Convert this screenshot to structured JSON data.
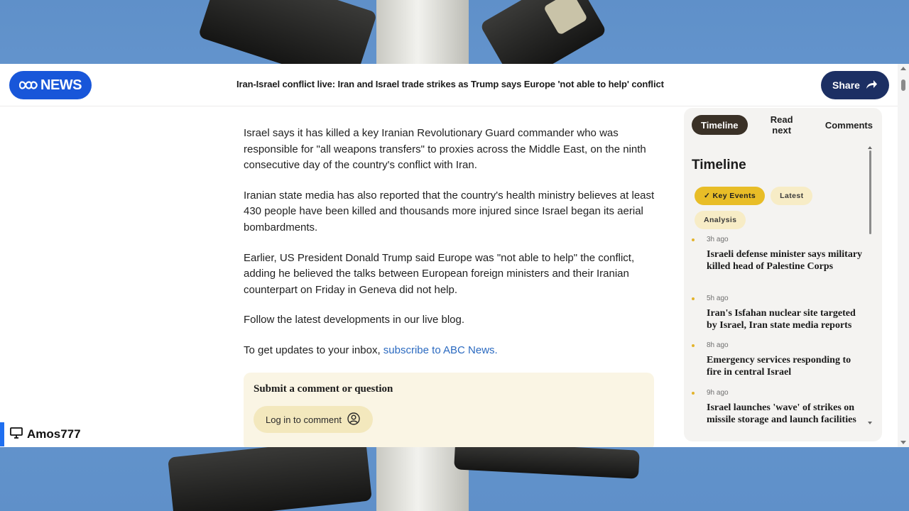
{
  "header": {
    "logo_text": "NEWS",
    "headline": "Iran-Israel conflict live: Iran and Israel trade strikes as Trump says Europe 'not able to help' conflict",
    "share_label": "Share"
  },
  "article": {
    "paragraphs": [
      "Israel says it has killed a key Iranian Revolutionary Guard commander who was responsible for \"all weapons transfers\" to proxies across the Middle East, on the ninth consecutive day of the country's conflict with Iran.",
      "Iranian state media has also reported that the country's health ministry believes at least 430 people have been killed and thousands more injured since Israel began its aerial bombardments.",
      "Earlier, US President Donald Trump said Europe was \"not able to help\" the conflict, adding he believed the talks between European foreign ministers and their Iranian counterpart on Friday in Geneva did not help.",
      "Follow the latest developments in our live blog."
    ],
    "updates_prefix": "To get updates to your inbox, ",
    "updates_link": "subscribe to ABC News."
  },
  "comment": {
    "title": "Submit a comment or question",
    "login_label": "Log in to comment"
  },
  "sidebar": {
    "tabs": [
      "Timeline",
      "Read next",
      "Comments"
    ],
    "active_tab": "Timeline",
    "title": "Timeline",
    "filters": [
      "✓ Key Events",
      "Latest",
      "Analysis"
    ],
    "events": [
      {
        "time": "3h ago",
        "title": "Israeli defense minister says military killed head of Palestine Corps"
      },
      {
        "time": "5h ago",
        "title": "Iran's Isfahan nuclear site targeted by Israel, Iran state media reports"
      },
      {
        "time": "8h ago",
        "title": "Emergency services responding to fire in central Israel"
      },
      {
        "time": "9h ago",
        "title": "Israel launches 'wave' of strikes on missile storage and launch facilities"
      }
    ]
  },
  "watermark": {
    "username": "Amos777"
  },
  "colors": {
    "brand_blue": "#1856d9",
    "share_navy": "#1c2f63",
    "chip_active": "#e8bd27",
    "link": "#2b6ac0"
  }
}
